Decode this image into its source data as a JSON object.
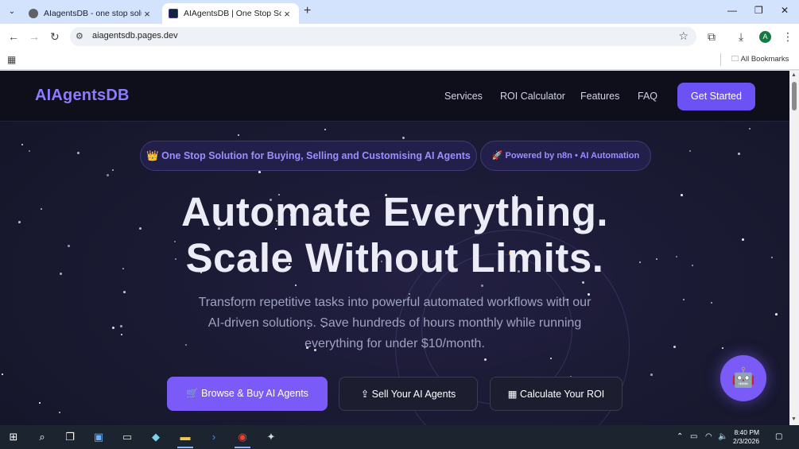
{
  "browser": {
    "tabs": [
      {
        "title": "AIagentsDB - one stop solution",
        "active": false
      },
      {
        "title": "AIAgentsDB | One Stop Solution",
        "active": true
      }
    ],
    "url": "aiagentsdb.pages.dev",
    "all_bookmarks": "All Bookmarks",
    "profile_initial": "A"
  },
  "site": {
    "logo": "AIAgentsDB",
    "nav": [
      "Services",
      "ROI Calculator",
      "Features",
      "FAQ"
    ],
    "cta": "Get Started",
    "pill_left": "👑 One Stop Solution for Buying, Selling and Customising AI Agents",
    "pill_right": "🚀 Powered by n8n • AI Automation",
    "hero_line1": "Automate Everything.",
    "hero_line2": "Scale Without Limits.",
    "subtitle": [
      "Transform repetitive tasks into powerful automated workflows with our",
      "AI-driven solutions. Save hundreds of hours monthly while running",
      "everything for under $10/month."
    ],
    "buttons": {
      "primary": "🛒 Browse & Buy AI Agents",
      "sell": "⇪ Sell Your AI Agents",
      "roi": "▦ Calculate Your ROI"
    },
    "chatbot_icon": "robot-icon",
    "accent_color": "#7b5bf7"
  },
  "taskbar": {
    "time": "8:40 PM",
    "date": "2/3/2026"
  }
}
